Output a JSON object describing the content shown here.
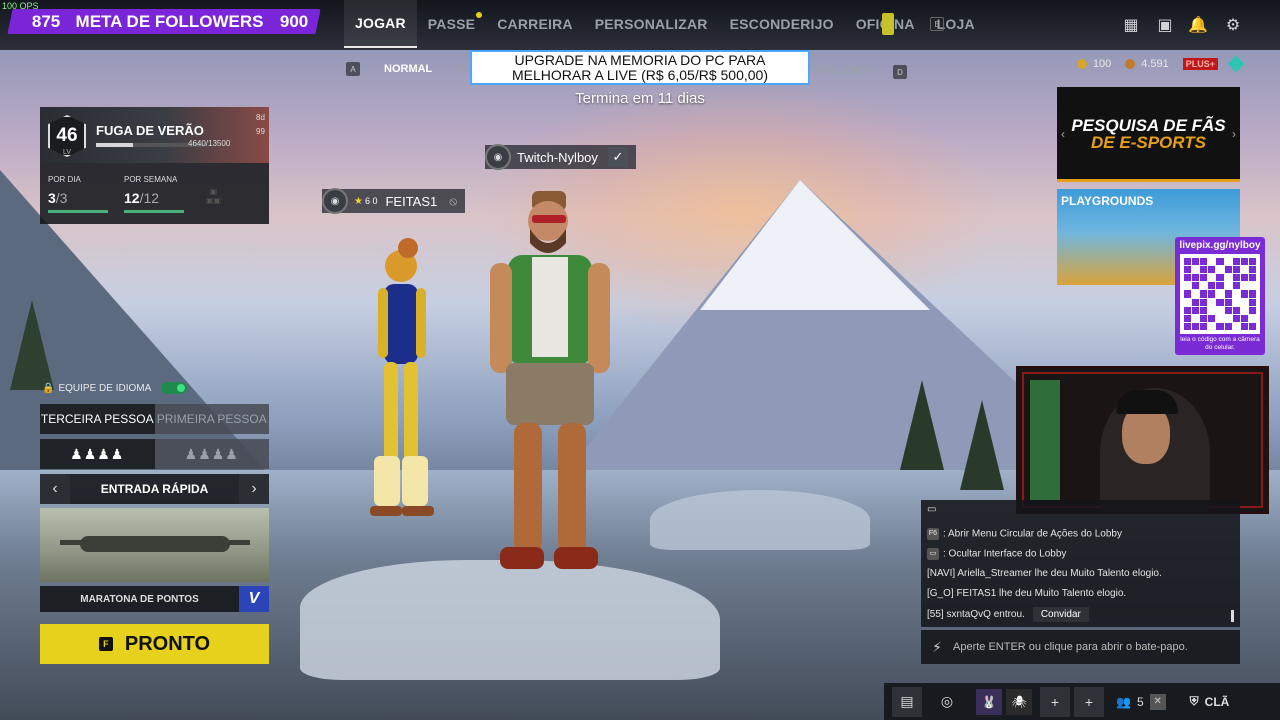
{
  "fps": "100 QPS",
  "followers": {
    "current": "875",
    "label": "META DE FOLLOWERS",
    "goal": "900"
  },
  "nav": {
    "items": [
      {
        "label": "JOGAR",
        "active": true
      },
      {
        "label": "PASSE"
      },
      {
        "label": "CARREIRA"
      },
      {
        "label": "PERSONALIZAR"
      },
      {
        "label": "ESCONDERIJO"
      },
      {
        "label": "OFICINA"
      },
      {
        "label": "LOJA"
      }
    ],
    "hotkey_right": "E"
  },
  "modes": {
    "key_left": "A",
    "normal": "NORMAL",
    "co": "CO",
    "personalizado": "ONALIZADO",
    "key_right": "D"
  },
  "upgrade_banner": {
    "line1": "UPGRADE NA MEMORIA DO PC PARA",
    "line2": "MELHORAR A LIVE (R$ 6,05/R$ 500,00)",
    "subtitle": "Termina em 11 dias"
  },
  "currency": {
    "gold": "100",
    "bp": "4.591",
    "plus": "PLUS+"
  },
  "pass_card": {
    "level": "46",
    "lv_label": "LV",
    "title": "FUGA DE VERÃO",
    "xp": "4640/13500",
    "xp_fraction": 0.34,
    "days": "8d",
    "count": "99",
    "daily_label": "POR DIA",
    "daily_done": "3",
    "daily_total": "/3",
    "weekly_label": "POR SEMANA",
    "weekly_done": "12",
    "weekly_total": "/12"
  },
  "players": {
    "main": {
      "name": "Twitch-Nylboy"
    },
    "teammate": {
      "name": "FEITAS1",
      "prefix": "6 0"
    }
  },
  "left_panel": {
    "lang_team": "EQUIPE DE IDIOMA",
    "third_person": "TERCEIRA PESSOA",
    "first_person": "PRIMEIRA PESSOA",
    "quick_entry": "ENTRADA RÁPIDA",
    "map_mode": "MARATONA DE PONTOS",
    "ready_key": "F",
    "ready": "PRONTO"
  },
  "ads": {
    "esports_line1": "PESQUISA DE FÃS",
    "esports_line2": "DE E-SPORTS",
    "playgrounds": "PLAYGROUNDS",
    "qr_title": "livepix.gg/nylboy",
    "qr_caption": "leia o código com a câmera do celular."
  },
  "chat": {
    "lines": [
      {
        "key": "F6",
        "text": ": Abrir Menu Circular de Ações do Lobby"
      },
      {
        "key": "▭",
        "text": ": Ocultar Interface do Lobby"
      },
      {
        "text": "[NAVI] Ariella_Streamer lhe deu Muito Talento elogio."
      },
      {
        "text": "[G_O] FEITAS1 lhe deu Muito Talento elogio."
      },
      {
        "text": "[55] sxntaQvQ entrou.",
        "action": "Convidar"
      }
    ],
    "input_placeholder": "Aperte ENTER ou clique para abrir o bate-papo."
  },
  "bottom_bar": {
    "party_count": "5",
    "clan": "CLÃ"
  }
}
